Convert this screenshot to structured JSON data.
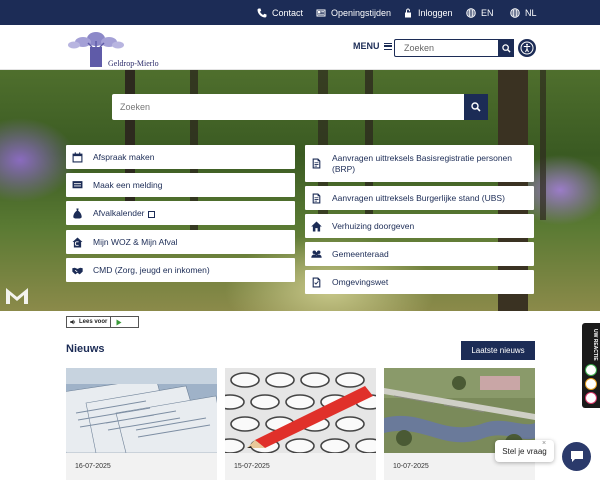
{
  "topbar": {
    "contact": "Contact",
    "hours": "Openingstijden",
    "login": "Inloggen",
    "lang_en": "EN",
    "lang_nl": "NL"
  },
  "header": {
    "logo_text": "Geldrop-Mierlo",
    "menu_label": "MENU",
    "search_placeholder": "Zoeken"
  },
  "hero": {
    "search_placeholder": "Zoeken"
  },
  "tiles_left": [
    {
      "label": "Afspraak maken",
      "icon": "calendar-icon"
    },
    {
      "label": "Maak een melding",
      "icon": "message-icon"
    },
    {
      "label": "Afvalkalender",
      "icon": "waste-bag-icon"
    },
    {
      "label": "Mijn WOZ & Mijn Afval",
      "icon": "euro-house-icon"
    },
    {
      "label": "CMD (Zorg, jeugd en inkomen)",
      "icon": "handshake-icon"
    }
  ],
  "tiles_right": [
    {
      "label": "Aanvragen uittreksels Basisregistratie personen (BRP)",
      "icon": "document-icon"
    },
    {
      "label": "Aanvragen uittreksels Burgerlijke stand (UBS)",
      "icon": "document-icon"
    },
    {
      "label": "Verhuizing doorgeven",
      "icon": "house-icon"
    },
    {
      "label": "Gemeenteraad",
      "icon": "people-icon"
    },
    {
      "label": "Omgevingswet",
      "icon": "document-check-icon"
    }
  ],
  "readspeaker": {
    "label": "Lees voor"
  },
  "news": {
    "title": "Nieuws",
    "latest_button": "Laatste nieuws",
    "items": [
      {
        "date": "16-07-2025"
      },
      {
        "date": "15-07-2025"
      },
      {
        "date": "10-07-2025"
      }
    ]
  },
  "feedback": {
    "label": "UW REACTIE"
  },
  "chat": {
    "bubble": "Stel je vraag",
    "close": "×"
  },
  "colors": {
    "primary": "#1c2c56",
    "accent_red": "#e0302a"
  }
}
